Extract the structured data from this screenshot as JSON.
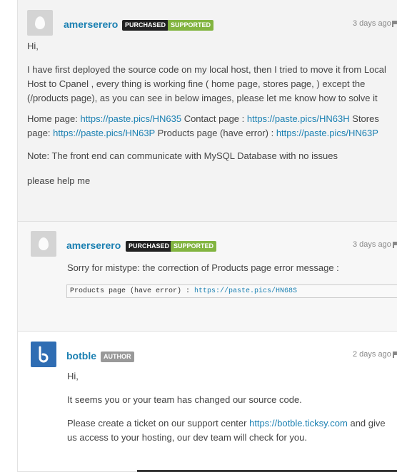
{
  "comments": [
    {
      "username": "amerserero",
      "badges": [
        "PURCHASED",
        "SUPPORTED"
      ],
      "time": "3 days ago",
      "greeting": "Hi,",
      "paragraph1": "I have first deployed the source code on my local host, then I tried to move it from Local Host to Cpanel , every thing is working fine ( home page, stores page, ) except the (/products page), as you can see in below images, please let me know how to solve it",
      "links": {
        "home_label": "Home page: ",
        "home_url": "https://paste.pics/HN635",
        "contact_label": " Contact page : ",
        "contact_url": "https://paste.pics/HN63H",
        "stores_label": " Stores page: ",
        "stores_url": "https://paste.pics/HN63P",
        "products_label": " Products page (have error) : ",
        "products_url": "https://paste.pics/HN63P"
      },
      "note": "Note: The front end can communicate with MySQL Database with no issues",
      "closing": "please help me"
    },
    {
      "username": "amerserero",
      "badges": [
        "PURCHASED",
        "SUPPORTED"
      ],
      "time": "3 days ago",
      "text": "Sorry for mistype: the correction of Products page error message :",
      "code_label": "Products page (have error) :  ",
      "code_url": "https://paste.pics/HN68S"
    },
    {
      "username": "botble",
      "badges": [
        "AUTHOR"
      ],
      "time": "2 days ago",
      "greeting": "Hi,",
      "paragraph1": "It seems you or your team has changed our source code.",
      "paragraph2_pre": "Please create a ticket on our support center ",
      "paragraph2_url": "https://botble.ticksy.com",
      "paragraph2_post": " and give us access to your hosting, our dev team will check for you."
    }
  ]
}
